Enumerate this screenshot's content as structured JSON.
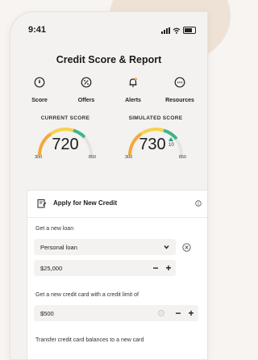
{
  "status": {
    "time": "9:41"
  },
  "header": {
    "title": "Credit Score & Report"
  },
  "nav": {
    "items": [
      {
        "label": "Score",
        "icon": "score-icon"
      },
      {
        "label": "Offers",
        "icon": "percent-icon"
      },
      {
        "label": "Alerts",
        "icon": "bell-icon"
      },
      {
        "label": "Resources",
        "icon": "more-icon"
      }
    ]
  },
  "scores": {
    "current": {
      "caption": "CURRENT SCORE",
      "value": "720",
      "min": "300",
      "max": "850"
    },
    "simulated": {
      "caption": "SIMULATED SCORE",
      "value": "730",
      "delta": "10",
      "min": "300",
      "max": "850"
    }
  },
  "apply_card": {
    "title": "Apply for New Credit",
    "loan": {
      "label": "Get a new loan",
      "type_value": "Personal loan",
      "amount_value": "$25,000"
    },
    "card": {
      "label": "Get a new credit card with a credit limit of",
      "limit_value": "$500"
    },
    "transfer": {
      "label": "Transfer credit card balances to a new card"
    }
  },
  "colors": {
    "gauge_start": "#f2a93b",
    "gauge_mid": "#f6d34a",
    "gauge_end": "#3fb58b",
    "accent_green": "#26a37c"
  }
}
